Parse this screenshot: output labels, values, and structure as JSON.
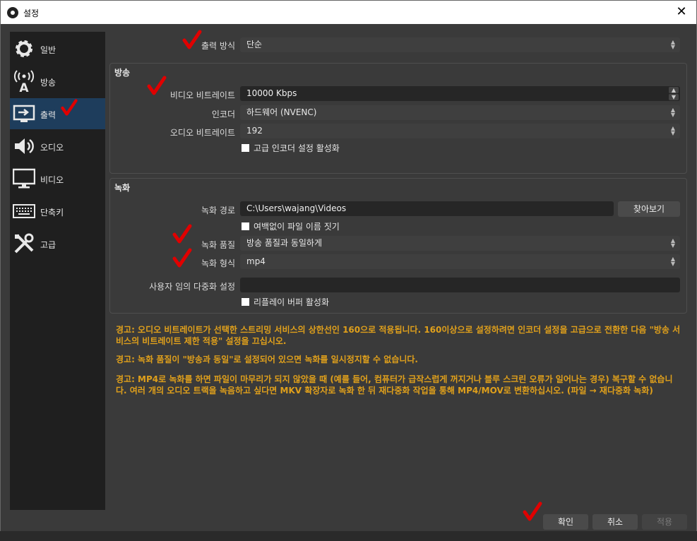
{
  "window": {
    "title": "설정",
    "close_glyph": "✕"
  },
  "sidebar": {
    "items": [
      {
        "label": "일반",
        "icon": "gear-icon"
      },
      {
        "label": "방송",
        "icon": "broadcast-icon"
      },
      {
        "label": "출력",
        "icon": "output-icon",
        "active": true
      },
      {
        "label": "오디오",
        "icon": "speaker-icon"
      },
      {
        "label": "비디오",
        "icon": "monitor-icon"
      },
      {
        "label": "단축키",
        "icon": "keyboard-icon"
      },
      {
        "label": "고급",
        "icon": "tools-icon"
      }
    ]
  },
  "output_mode": {
    "label": "출력 방식",
    "value": "단순"
  },
  "streaming": {
    "title": "방송",
    "video_bitrate_label": "비디오 비트레이트",
    "video_bitrate_value": "10000 Kbps",
    "encoder_label": "인코더",
    "encoder_value": "하드웨어 (NVENC)",
    "audio_bitrate_label": "오디오 비트레이트",
    "audio_bitrate_value": "192",
    "advanced_encoder_label": "고급 인코더 설정 활성화"
  },
  "recording": {
    "title": "녹화",
    "path_label": "녹화 경로",
    "path_value": "C:\\Users\\wajang\\Videos",
    "browse_label": "찾아보기",
    "no_space_label": "여백없이 파일 이름 짓기",
    "quality_label": "녹화 품질",
    "quality_value": "방송 품질과 동일하게",
    "format_label": "녹화 형식",
    "format_value": "mp4",
    "mux_label": "사용자 임의 다중화 설정",
    "mux_value": "",
    "replay_label": "리플레이 버퍼 활성화"
  },
  "warnings": [
    "경고: 오디오 비트레이트가 선택한 스트리밍 서비스의 상한선인 160으로 적용됩니다. 160이상으로 설정하려면 인코더 설정을 고급으로 전환한 다음 \"방송 서비스의 비트레이트 제한 적용\" 설정을 끄십시오.",
    "경고: 녹화 품질이 \"방송과 동일\"로 설정되어 있으면 녹화를 일시정지할 수 없습니다.",
    "경고: MP4로 녹화를 하면 파일이 마무리가 되지 않았을 때 (예를 들어, 컴퓨터가 급작스럽게 꺼지거나 블루 스크린 오류가 일어나는 경우) 복구할 수 없습니다. 여러 개의 오디오 트랙을 녹음하고 싶다면 MKV 확장자로 녹화 한 뒤 재다중화 작업을 통해 MP4/MOV로 변환하십시오. (파일 → 재다중화 녹화)"
  ],
  "footer": {
    "ok_label": "확인",
    "cancel_label": "취소",
    "apply_label": "적용"
  },
  "colors": {
    "accent": "#1e3d5c",
    "warning": "#e0a01b",
    "check_mark": "#e00000"
  }
}
